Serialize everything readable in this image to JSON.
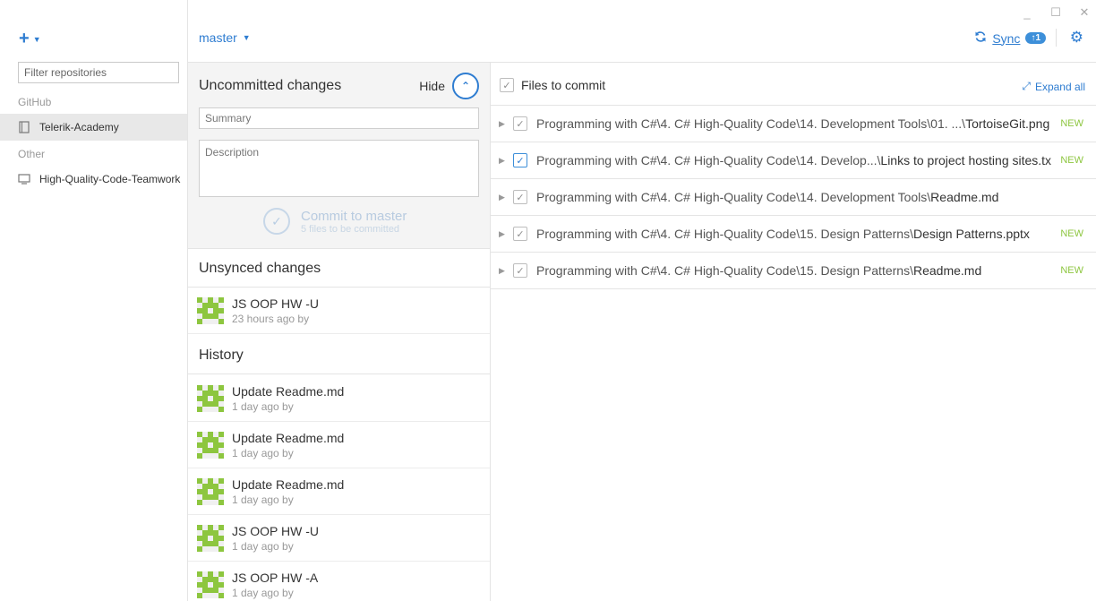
{
  "window": {
    "minimize": "_",
    "maximize": "☐",
    "close": "✕"
  },
  "sidebar": {
    "add_label": "+",
    "filter_placeholder": "Filter repositories",
    "groups": [
      {
        "label": "GitHub",
        "repos": [
          {
            "name": "Telerik-Academy",
            "selected": true
          }
        ]
      },
      {
        "label": "Other",
        "repos": [
          {
            "name": "High-Quality-Code-Teamwork",
            "selected": false
          }
        ]
      }
    ]
  },
  "topbar": {
    "branch": "master",
    "sync_label": "Sync",
    "sync_badge": "↑1"
  },
  "uncommitted": {
    "title": "Uncommitted changes",
    "hide_label": "Hide",
    "summary_placeholder": "Summary",
    "description_placeholder": "Description",
    "commit_title": "Commit to master",
    "commit_sub": "5 files to be committed"
  },
  "unsynced": {
    "title": "Unsynced changes",
    "commits": [
      {
        "message": "JS OOP HW -U",
        "time": "23 hours ago by"
      }
    ]
  },
  "history": {
    "title": "History",
    "commits": [
      {
        "message": "Update Readme.md",
        "time": "1 day ago by"
      },
      {
        "message": "Update Readme.md",
        "time": "1 day ago by"
      },
      {
        "message": "Update Readme.md",
        "time": "1 day ago by"
      },
      {
        "message": "JS OOP HW -U",
        "time": "1 day ago by"
      },
      {
        "message": "JS OOP HW -A",
        "time": "1 day ago by"
      }
    ]
  },
  "files": {
    "header_label": "Files to commit",
    "expand_all": "Expand all",
    "items": [
      {
        "path": "Programming with C#\\4. C# High-Quality Code\\14. Development Tools\\01. ...\\",
        "file": "TortoiseGit.png",
        "badge": "NEW"
      },
      {
        "path": "Programming with C#\\4. C# High-Quality Code\\14. Develop...\\",
        "file": "Links to project hosting sites.txt",
        "badge": "NEW"
      },
      {
        "path": "Programming with C#\\4. C# High-Quality Code\\14. Development Tools\\",
        "file": "Readme.md",
        "badge": ""
      },
      {
        "path": "Programming with C#\\4. C# High-Quality Code\\15. Design Patterns\\",
        "file": "Design Patterns.pptx",
        "badge": "NEW"
      },
      {
        "path": "Programming with C#\\4. C# High-Quality Code\\15. Design Patterns\\",
        "file": "Readme.md",
        "badge": "NEW"
      }
    ]
  },
  "colors": {
    "accent": "#2f7dd1",
    "new": "#8dc63f",
    "avatar": "#8dc63f"
  },
  "icons": {
    "add": "plus-icon",
    "sync": "sync-icon",
    "settings": "gear-icon",
    "expand": "expand-icon"
  }
}
